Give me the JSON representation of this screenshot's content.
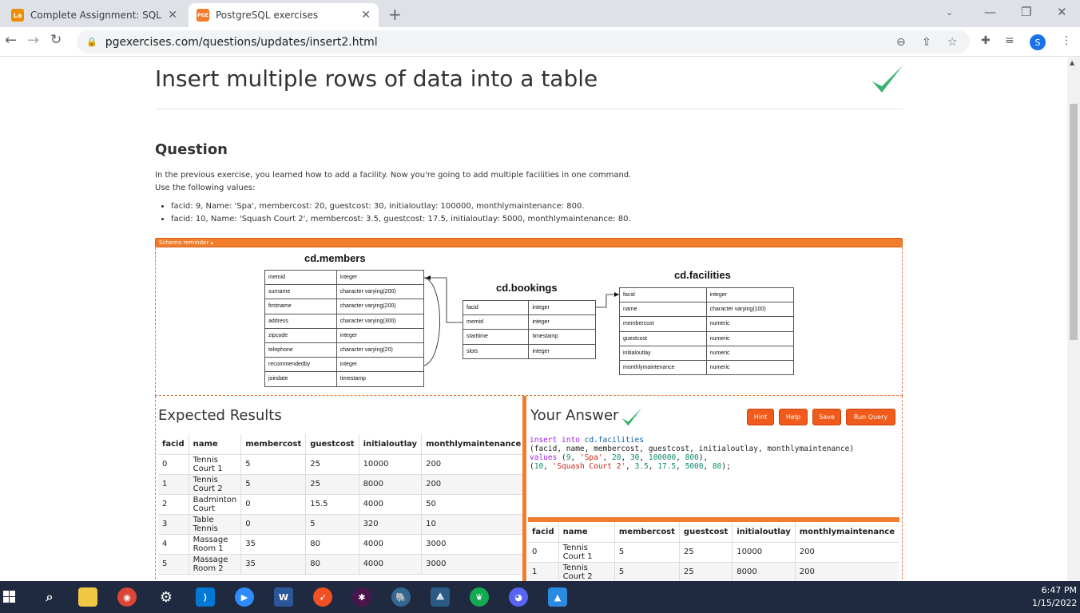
{
  "browser": {
    "tabs": [
      {
        "title": "Complete Assignment: SQL Practi",
        "favicon": "La",
        "active": false
      },
      {
        "title": "PostgreSQL exercises",
        "favicon": "PGE",
        "active": true
      }
    ],
    "url": "pgexercises.com/questions/updates/insert2.html",
    "profile_initial": "S"
  },
  "page": {
    "title": "Insert multiple rows of data into a table",
    "question_heading": "Question",
    "question_line1": "In the previous exercise, you learned how to add a facility. Now you're going to add multiple facilities in one command.",
    "question_line2": "Use the following values:",
    "values_list": [
      "facid: 9, Name: 'Spa', membercost: 20, guestcost: 30, initialoutlay: 100000, monthlymaintenance: 800.",
      "facid: 10, Name: 'Squash Court 2', membercost: 3.5, guestcost: 17.5, initialoutlay: 5000, monthlymaintenance: 80."
    ],
    "schema_reminder": "Schema reminder ▴"
  },
  "schema": {
    "members": {
      "title": "cd.members",
      "rows": [
        [
          "memid",
          "integer"
        ],
        [
          "surname",
          "character varying(200)"
        ],
        [
          "firstname",
          "character varying(200)"
        ],
        [
          "address",
          "character varying(300)"
        ],
        [
          "zipcode",
          "integer"
        ],
        [
          "telephone",
          "character varying(20)"
        ],
        [
          "recommendedby",
          "integer"
        ],
        [
          "joindate",
          "timestamp"
        ]
      ]
    },
    "bookings": {
      "title": "cd.bookings",
      "rows": [
        [
          "facid",
          "integer"
        ],
        [
          "memid",
          "integer"
        ],
        [
          "starttime",
          "timestamp"
        ],
        [
          "slots",
          "integer"
        ]
      ]
    },
    "facilities": {
      "title": "cd.facilities",
      "rows": [
        [
          "facid",
          "integer"
        ],
        [
          "name",
          "character varying(100)"
        ],
        [
          "membercost",
          "numeric"
        ],
        [
          "guestcost",
          "numeric"
        ],
        [
          "initialoutlay",
          "numeric"
        ],
        [
          "monthlymaintenance",
          "numeric"
        ]
      ]
    }
  },
  "expected": {
    "heading": "Expected Results",
    "columns": [
      "facid",
      "name",
      "membercost",
      "guestcost",
      "initialoutlay",
      "monthlymaintenance"
    ],
    "rows": [
      [
        "0",
        "Tennis Court 1",
        "5",
        "25",
        "10000",
        "200"
      ],
      [
        "1",
        "Tennis Court 2",
        "5",
        "25",
        "8000",
        "200"
      ],
      [
        "2",
        "Badminton Court",
        "0",
        "15.5",
        "4000",
        "50"
      ],
      [
        "3",
        "Table Tennis",
        "0",
        "5",
        "320",
        "10"
      ],
      [
        "4",
        "Massage Room 1",
        "35",
        "80",
        "4000",
        "3000"
      ],
      [
        "5",
        "Massage Room 2",
        "35",
        "80",
        "4000",
        "3000"
      ]
    ]
  },
  "answer": {
    "heading": "Your Answer",
    "buttons": {
      "hint": "Hint",
      "help": "Help",
      "save": "Save",
      "run": "Run Query"
    },
    "code": {
      "l1_kw": "insert into ",
      "l1_tbl": "cd.facilities",
      "l2": "(facid, name, membercost, guestcost, initialoutlay, monthlymaintenance)",
      "l3_kw": "values ",
      "l3_a": "(",
      "l3_n1": "9",
      "l3_b": ", ",
      "l3_s": "'Spa'",
      "l3_c": ", ",
      "l3_n2": "20",
      "l3_d": ", ",
      "l3_n3": "30",
      "l3_e": ", ",
      "l3_n4": "100000",
      "l3_f": ", ",
      "l3_n5": "800",
      "l3_g": "),",
      "l4_a": "(",
      "l4_n1": "10",
      "l4_b": ", ",
      "l4_s": "'Squash Court 2'",
      "l4_c": ", ",
      "l4_n2": "3.5",
      "l4_d": ", ",
      "l4_n3": "17.5",
      "l4_e": ", ",
      "l4_n4": "5000",
      "l4_f": ", ",
      "l4_n5": "80",
      "l4_g": ");"
    },
    "columns": [
      "facid",
      "name",
      "membercost",
      "guestcost",
      "initialoutlay",
      "monthlymaintenance"
    ],
    "rows": [
      [
        "0",
        "Tennis Court 1",
        "5",
        "25",
        "10000",
        "200"
      ],
      [
        "1",
        "Tennis Court 2",
        "5",
        "25",
        "8000",
        "200"
      ]
    ]
  },
  "taskbar": {
    "time": "6:47 PM",
    "date": "1/15/2022"
  },
  "colors": {
    "accent": "#f07c2c",
    "button": "#f05a1a",
    "check": "#3cb371"
  }
}
